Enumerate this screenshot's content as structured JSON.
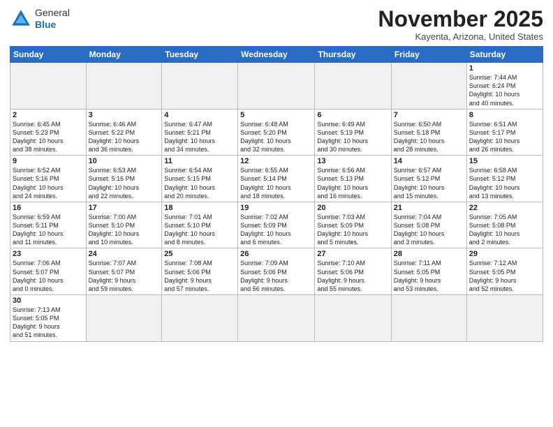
{
  "logo": {
    "general": "General",
    "blue": "Blue"
  },
  "header": {
    "title": "November 2025",
    "subtitle": "Kayenta, Arizona, United States"
  },
  "weekdays": [
    "Sunday",
    "Monday",
    "Tuesday",
    "Wednesday",
    "Thursday",
    "Friday",
    "Saturday"
  ],
  "days": [
    {
      "day": "",
      "info": ""
    },
    {
      "day": "",
      "info": ""
    },
    {
      "day": "",
      "info": ""
    },
    {
      "day": "",
      "info": ""
    },
    {
      "day": "",
      "info": ""
    },
    {
      "day": "",
      "info": ""
    },
    {
      "day": "1",
      "info": "Sunrise: 7:44 AM\nSunset: 6:24 PM\nDaylight: 10 hours\nand 40 minutes."
    },
    {
      "day": "2",
      "info": "Sunrise: 6:45 AM\nSunset: 5:23 PM\nDaylight: 10 hours\nand 38 minutes."
    },
    {
      "day": "3",
      "info": "Sunrise: 6:46 AM\nSunset: 5:22 PM\nDaylight: 10 hours\nand 36 minutes."
    },
    {
      "day": "4",
      "info": "Sunrise: 6:47 AM\nSunset: 5:21 PM\nDaylight: 10 hours\nand 34 minutes."
    },
    {
      "day": "5",
      "info": "Sunrise: 6:48 AM\nSunset: 5:20 PM\nDaylight: 10 hours\nand 32 minutes."
    },
    {
      "day": "6",
      "info": "Sunrise: 6:49 AM\nSunset: 5:19 PM\nDaylight: 10 hours\nand 30 minutes."
    },
    {
      "day": "7",
      "info": "Sunrise: 6:50 AM\nSunset: 5:18 PM\nDaylight: 10 hours\nand 28 minutes."
    },
    {
      "day": "8",
      "info": "Sunrise: 6:51 AM\nSunset: 5:17 PM\nDaylight: 10 hours\nand 26 minutes."
    },
    {
      "day": "9",
      "info": "Sunrise: 6:52 AM\nSunset: 5:16 PM\nDaylight: 10 hours\nand 24 minutes."
    },
    {
      "day": "10",
      "info": "Sunrise: 6:53 AM\nSunset: 5:16 PM\nDaylight: 10 hours\nand 22 minutes."
    },
    {
      "day": "11",
      "info": "Sunrise: 6:54 AM\nSunset: 5:15 PM\nDaylight: 10 hours\nand 20 minutes."
    },
    {
      "day": "12",
      "info": "Sunrise: 6:55 AM\nSunset: 5:14 PM\nDaylight: 10 hours\nand 18 minutes."
    },
    {
      "day": "13",
      "info": "Sunrise: 6:56 AM\nSunset: 5:13 PM\nDaylight: 10 hours\nand 16 minutes."
    },
    {
      "day": "14",
      "info": "Sunrise: 6:57 AM\nSunset: 5:12 PM\nDaylight: 10 hours\nand 15 minutes."
    },
    {
      "day": "15",
      "info": "Sunrise: 6:58 AM\nSunset: 5:12 PM\nDaylight: 10 hours\nand 13 minutes."
    },
    {
      "day": "16",
      "info": "Sunrise: 6:59 AM\nSunset: 5:11 PM\nDaylight: 10 hours\nand 11 minutes."
    },
    {
      "day": "17",
      "info": "Sunrise: 7:00 AM\nSunset: 5:10 PM\nDaylight: 10 hours\nand 10 minutes."
    },
    {
      "day": "18",
      "info": "Sunrise: 7:01 AM\nSunset: 5:10 PM\nDaylight: 10 hours\nand 8 minutes."
    },
    {
      "day": "19",
      "info": "Sunrise: 7:02 AM\nSunset: 5:09 PM\nDaylight: 10 hours\nand 6 minutes."
    },
    {
      "day": "20",
      "info": "Sunrise: 7:03 AM\nSunset: 5:09 PM\nDaylight: 10 hours\nand 5 minutes."
    },
    {
      "day": "21",
      "info": "Sunrise: 7:04 AM\nSunset: 5:08 PM\nDaylight: 10 hours\nand 3 minutes."
    },
    {
      "day": "22",
      "info": "Sunrise: 7:05 AM\nSunset: 5:08 PM\nDaylight: 10 hours\nand 2 minutes."
    },
    {
      "day": "23",
      "info": "Sunrise: 7:06 AM\nSunset: 5:07 PM\nDaylight: 10 hours\nand 0 minutes."
    },
    {
      "day": "24",
      "info": "Sunrise: 7:07 AM\nSunset: 5:07 PM\nDaylight: 9 hours\nand 59 minutes."
    },
    {
      "day": "25",
      "info": "Sunrise: 7:08 AM\nSunset: 5:06 PM\nDaylight: 9 hours\nand 57 minutes."
    },
    {
      "day": "26",
      "info": "Sunrise: 7:09 AM\nSunset: 5:06 PM\nDaylight: 9 hours\nand 56 minutes."
    },
    {
      "day": "27",
      "info": "Sunrise: 7:10 AM\nSunset: 5:06 PM\nDaylight: 9 hours\nand 55 minutes."
    },
    {
      "day": "28",
      "info": "Sunrise: 7:11 AM\nSunset: 5:05 PM\nDaylight: 9 hours\nand 53 minutes."
    },
    {
      "day": "29",
      "info": "Sunrise: 7:12 AM\nSunset: 5:05 PM\nDaylight: 9 hours\nand 52 minutes."
    },
    {
      "day": "30",
      "info": "Sunrise: 7:13 AM\nSunset: 5:05 PM\nDaylight: 9 hours\nand 51 minutes."
    },
    {
      "day": "",
      "info": ""
    },
    {
      "day": "",
      "info": ""
    },
    {
      "day": "",
      "info": ""
    },
    {
      "day": "",
      "info": ""
    },
    {
      "day": "",
      "info": ""
    },
    {
      "day": "",
      "info": ""
    }
  ]
}
